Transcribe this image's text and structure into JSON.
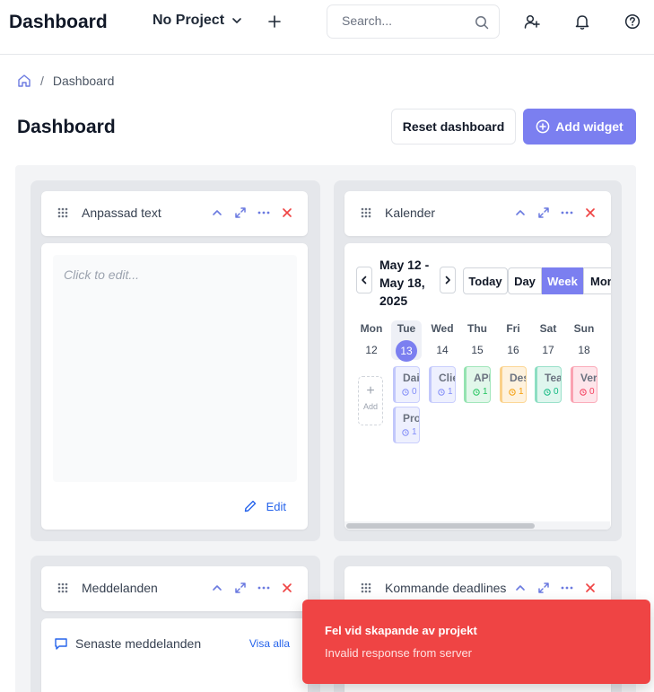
{
  "header": {
    "app_title": "Dashboard",
    "project_label": "No Project",
    "search_placeholder": "Search..."
  },
  "breadcrumb": {
    "current": "Dashboard",
    "separator": "/"
  },
  "page": {
    "title": "Dashboard",
    "reset_label": "Reset dashboard",
    "add_widget_label": "Add widget"
  },
  "widgets": {
    "text": {
      "title": "Anpassad text",
      "placeholder": "Click to edit...",
      "edit_label": "Edit"
    },
    "calendar": {
      "title": "Kalender",
      "range": "May 12 - May 18, 2025",
      "today_label": "Today",
      "views": [
        "Day",
        "Week",
        "Mon"
      ],
      "active_view": "Week",
      "days": [
        {
          "name": "Mon",
          "num": "12"
        },
        {
          "name": "Tue",
          "num": "13"
        },
        {
          "name": "Wed",
          "num": "14"
        },
        {
          "name": "Thu",
          "num": "15"
        },
        {
          "name": "Fri",
          "num": "16"
        },
        {
          "name": "Sat",
          "num": "17"
        },
        {
          "name": "Sun",
          "num": "18"
        }
      ],
      "today_index": 1,
      "add_label": "Add",
      "events": [
        {
          "day": 1,
          "text": "Dail",
          "sub": "0",
          "color": "#818cf8"
        },
        {
          "day": 1,
          "text": "Proj",
          "sub": "1",
          "color": "#818cf8"
        },
        {
          "day": 2,
          "text": "Clie",
          "sub": "1",
          "color": "#818cf8"
        },
        {
          "day": 3,
          "text": "API",
          "sub": "1",
          "color": "#22c55e"
        },
        {
          "day": 4,
          "text": "Des",
          "sub": "1",
          "color": "#f59e0b"
        },
        {
          "day": 5,
          "text": "Tear",
          "sub": "0",
          "color": "#10b981"
        },
        {
          "day": 6,
          "text": "Vers",
          "sub": "0",
          "color": "#f43f5e"
        }
      ]
    },
    "messages": {
      "title": "Meddelanden",
      "subtitle": "Senaste meddelanden",
      "link": "Visa alla"
    },
    "deadlines": {
      "title": "Kommande deadlines"
    }
  },
  "toast": {
    "title": "Fel vid skapande av projekt",
    "message": "Invalid response from server",
    "color": "#ef4444"
  },
  "colors": {
    "accent": "#7b7ff0",
    "danger": "#ef4444",
    "link": "#2563eb"
  }
}
